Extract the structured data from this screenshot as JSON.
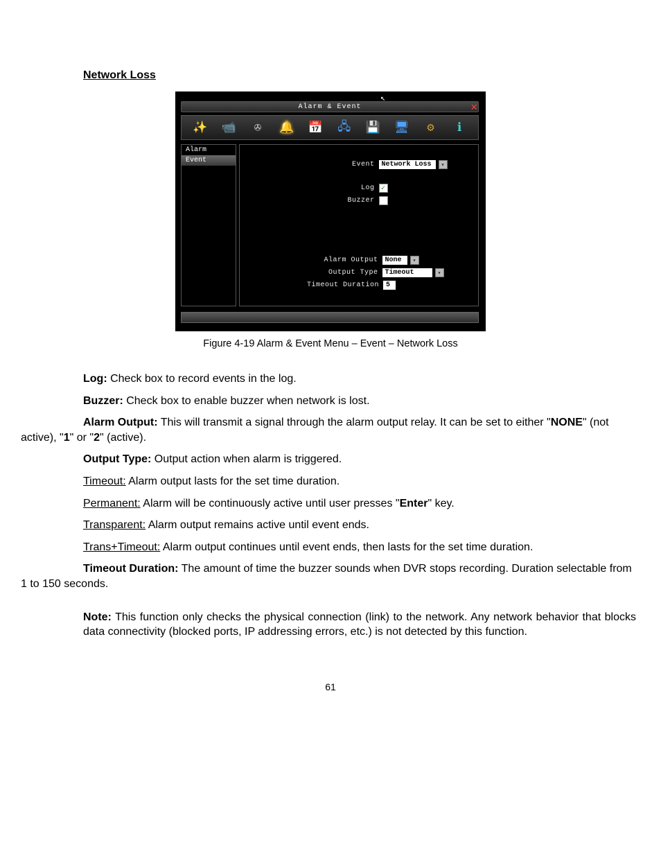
{
  "section_heading": "Network Loss",
  "shot": {
    "title": "Alarm & Event",
    "sidebar": {
      "item0": "Alarm",
      "item1": "Event"
    },
    "labels": {
      "event": "Event",
      "log": "Log",
      "buzzer": "Buzzer",
      "alarm_output": "Alarm Output",
      "output_type": "Output Type",
      "timeout_duration": "Timeout Duration"
    },
    "values": {
      "event": "Network Loss",
      "alarm_output": "None",
      "output_type": "Timeout",
      "timeout_duration": "5"
    },
    "checks": {
      "log": "✓",
      "buzzer": ""
    }
  },
  "caption": "Figure 4-19 Alarm & Event Menu – Event – Network Loss",
  "body": {
    "log_lead": "Log:",
    "log_text": " Check box to record events in the log.",
    "buzzer_lead": "Buzzer:",
    "buzzer_text": " Check box to enable buzzer when network is lost.",
    "alarm_output_lead": "Alarm Output:",
    "alarm_output_text_a": " This will transmit a signal through the alarm output relay. It can be set to either \"",
    "alarm_output_none": "NONE",
    "alarm_output_text_b": "\" (not active), \"",
    "alarm_output_1": "1",
    "alarm_output_text_c": "\" or \"",
    "alarm_output_2": "2",
    "alarm_output_text_d": "\" (active).",
    "output_type_lead": "Output Type:",
    "output_type_text": " Output action when alarm is triggered.",
    "timeout_term": "Timeout:",
    "timeout_text": " Alarm output lasts for the set time duration.",
    "permanent_term": "Permanent:",
    "permanent_text_a": " Alarm will be continuously active until user presses \"",
    "permanent_enter": "Enter",
    "permanent_text_b": "\" key.",
    "transparent_term": "Transparent:",
    "transparent_text": " Alarm output remains active until event ends.",
    "transtimeout_term": "Trans+Timeout:",
    "transtimeout_text": " Alarm output continues until event ends, then lasts for the set time duration.",
    "td_lead": "Timeout Duration:",
    "td_text": " The amount of time the buzzer sounds when DVR stops recording. Duration selectable from 1 to 150 seconds.",
    "note_lead": "Note:",
    "note_text": " This function only checks the physical connection (link) to the network. Any network behavior that blocks data connectivity (blocked ports, IP addressing errors, etc.) is not detected by this function."
  },
  "pagenum": "61"
}
